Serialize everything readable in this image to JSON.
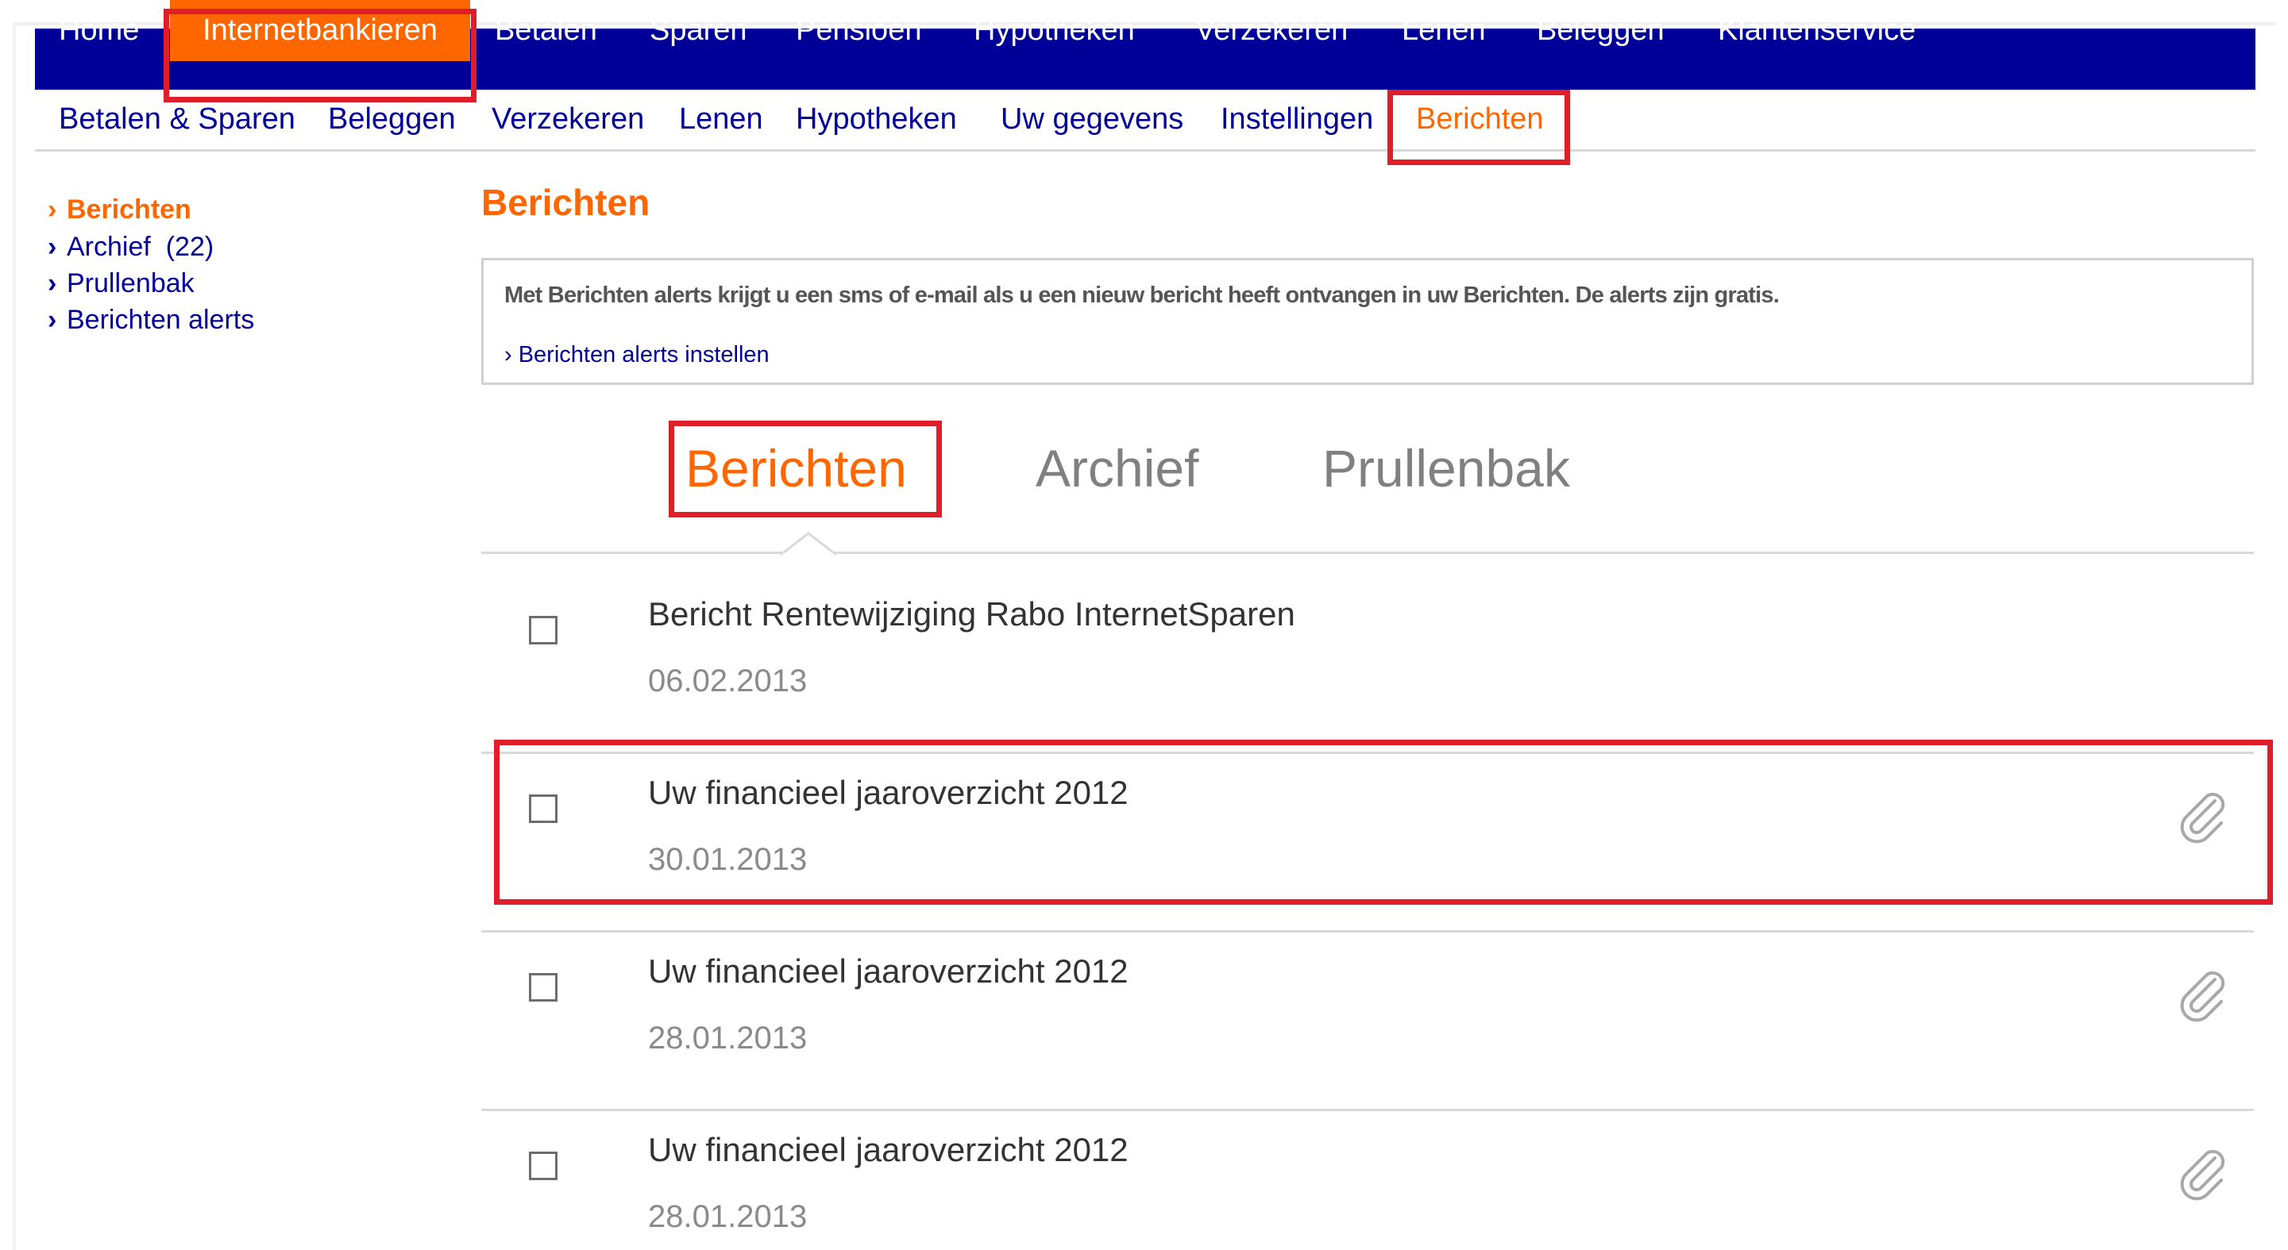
{
  "top_nav": [
    {
      "label": "Home",
      "active": false
    },
    {
      "label": "Internetbankieren",
      "active": true
    },
    {
      "label": "Betalen",
      "active": false
    },
    {
      "label": "Sparen",
      "active": false
    },
    {
      "label": "Pensioen",
      "active": false
    },
    {
      "label": "Hypotheken",
      "active": false
    },
    {
      "label": "Verzekeren",
      "active": false
    },
    {
      "label": "Lenen",
      "active": false
    },
    {
      "label": "Beleggen",
      "active": false
    },
    {
      "label": "Klantenservice",
      "active": false
    }
  ],
  "sub_nav": [
    {
      "label": "Betalen & Sparen",
      "active": false
    },
    {
      "label": "Beleggen",
      "active": false
    },
    {
      "label": "Verzekeren",
      "active": false
    },
    {
      "label": "Lenen",
      "active": false
    },
    {
      "label": "Hypotheken",
      "active": false
    },
    {
      "label": "Uw gegevens",
      "active": false
    },
    {
      "label": "Instellingen",
      "active": false
    },
    {
      "label": "Berichten",
      "active": true
    }
  ],
  "sidebar": [
    {
      "label": "Berichten",
      "active": true
    },
    {
      "label": "Archief  (22)",
      "active": false
    },
    {
      "label": "Prullenbak",
      "active": false
    },
    {
      "label": "Berichten alerts",
      "active": false
    }
  ],
  "sidebar_chevron": "›",
  "page_title": "Berichten",
  "info_box": {
    "text": "Met Berichten alerts krijgt u een sms of e-mail als u een nieuw bericht heeft ontvangen in uw Berichten. De alerts zijn gratis.",
    "link": "› Berichten alerts instellen"
  },
  "tabs": [
    {
      "label": "Berichten",
      "active": true
    },
    {
      "label": "Archief",
      "active": false
    },
    {
      "label": "Prullenbak",
      "active": false
    }
  ],
  "messages": [
    {
      "title": "Bericht Rentewijziging Rabo InternetSparen",
      "date": "06.02.2013",
      "attachment": false
    },
    {
      "title": "Uw financieel jaaroverzicht 2012",
      "date": "30.01.2013",
      "attachment": true
    },
    {
      "title": "Uw financieel jaaroverzicht 2012",
      "date": "28.01.2013",
      "attachment": true
    },
    {
      "title": "Uw financieel jaaroverzicht 2012",
      "date": "28.01.2013",
      "attachment": true
    }
  ],
  "colors": {
    "nav_blue": "#000099",
    "accent_orange": "#fe6600",
    "highlight_red": "#e01e2a",
    "divider_gray": "#d9d9d9"
  },
  "icons": {
    "attachment": "paperclip-icon",
    "checkbox": "checkbox-empty"
  }
}
